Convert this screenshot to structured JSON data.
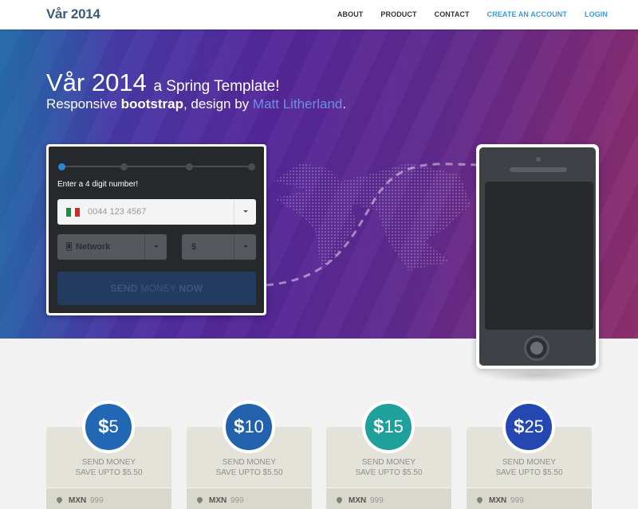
{
  "nav": {
    "logo": "Vår 2014",
    "items": [
      {
        "label": "ABOUT"
      },
      {
        "label": "PRODUCT"
      },
      {
        "label": "CONTACT"
      },
      {
        "label": "CREATE AN ACCOUNT"
      },
      {
        "label": "LOGIN"
      }
    ]
  },
  "hero": {
    "title_main": "Vår 2014",
    "title_small": "a Spring Template!",
    "sub_1": "Responsive ",
    "sub_bold": "bootstrap",
    "sub_2": ", design by ",
    "sub_link": "Matt Litherland",
    "sub_end": "."
  },
  "form": {
    "prompt": "Enter a 4 digit number!",
    "phone_placeholder": "0044 123 4567",
    "network_label": "Network",
    "currency_label": "$",
    "send_1": "SEND ",
    "send_2": "MONEY ",
    "send_3": "NOW",
    "active_step": 1,
    "steps": 4
  },
  "cards": [
    {
      "symbol": "$",
      "amount": "5",
      "line1": "SEND MONEY",
      "line2": "SAVE UPTO $5.50",
      "currency": "MXN",
      "value": "999",
      "color": "#2267b4"
    },
    {
      "symbol": "$",
      "amount": "10",
      "line1": "SEND MONEY",
      "line2": "SAVE UPTO $5.50",
      "currency": "MXN",
      "value": "999",
      "color": "#2262ad"
    },
    {
      "symbol": "$",
      "amount": "15",
      "line1": "SEND MONEY",
      "line2": "SAVE UPTO $5.50",
      "currency": "MXN",
      "value": "999",
      "color": "#1fa09a"
    },
    {
      "symbol": "$",
      "amount": "25",
      "line1": "SEND MONEY",
      "line2": "SAVE UPTO $5.50",
      "currency": "MXN",
      "value": "999",
      "color": "#2447b2"
    }
  ]
}
